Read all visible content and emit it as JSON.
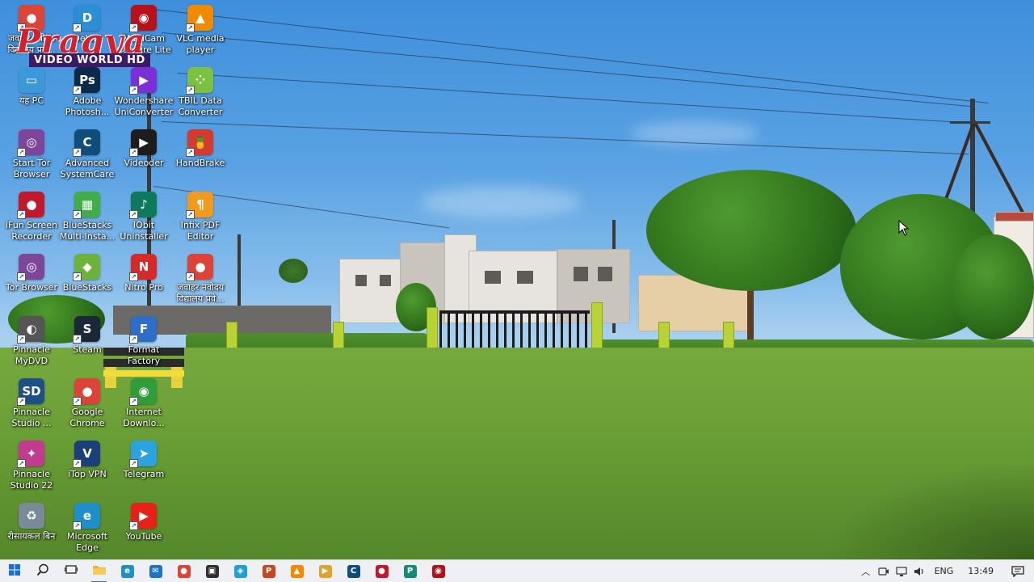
{
  "wallpaper": {
    "description_colors": {
      "sky": "#5aa2e3",
      "grass": "#6ea238",
      "fence": "#b9d334"
    }
  },
  "watermark": {
    "script_text": "Pragya",
    "band_text": "VIDEO WORLD HD"
  },
  "desktop": {
    "icons": [
      {
        "label": "जवाहर नवोदय विद्यालय प्रवे...",
        "icon": "chrome-icon",
        "color": "#db4437"
      },
      {
        "label": "Delphi",
        "icon": "delphi-icon",
        "color": "#2b8fd6"
      },
      {
        "label": "MultiCam Capture Lite",
        "icon": "multicam-icon",
        "color": "#b5121b"
      },
      {
        "label": "VLC media player",
        "icon": "vlc-icon",
        "color": "#f08a00"
      },
      {
        "label": "यह PC",
        "icon": "this-pc-icon",
        "color": "#3a9ad9"
      },
      {
        "label": "Adobe Photosh...",
        "icon": "photoshop-icon",
        "color": "#0b2a4a"
      },
      {
        "label": "Wondershare UniConverter",
        "icon": "uniconverter-icon",
        "color": "#7b2fd6"
      },
      {
        "label": "TBIL Data Converter",
        "icon": "tbil-icon",
        "color": "#7cc242"
      },
      {
        "label": "Start Tor Browser",
        "icon": "tor-icon",
        "color": "#7d4698"
      },
      {
        "label": "Advanced SystemCare",
        "icon": "systemcare-icon",
        "color": "#0f4d7a"
      },
      {
        "label": "Videoder",
        "icon": "videoder-icon",
        "color": "#1d1d1d"
      },
      {
        "label": "HandBrake",
        "icon": "handbrake-icon",
        "color": "#d43a2f"
      },
      {
        "label": "iFun Screen Recorder",
        "icon": "ifun-icon",
        "color": "#c2182b"
      },
      {
        "label": "BlueStacks Multi-Insta...",
        "icon": "bluestacks-multi-icon",
        "color": "#3fae49"
      },
      {
        "label": "IObit Uninstaller",
        "icon": "iobit-icon",
        "color": "#0e7a5c"
      },
      {
        "label": "Infix PDF Editor",
        "icon": "infix-icon",
        "color": "#f29a1e"
      },
      {
        "label": "Tor Browser",
        "icon": "tor-browser-icon",
        "color": "#7d4698"
      },
      {
        "label": "BlueStacks",
        "icon": "bluestacks-icon",
        "color": "#6cb33e"
      },
      {
        "label": "Nitro Pro",
        "icon": "nitro-icon",
        "color": "#d62a2a"
      },
      {
        "label": "जवाहर नवोदय विद्यालय प्रवे...",
        "icon": "chrome-icon",
        "color": "#db4437"
      },
      {
        "label": "Pinnacle MyDVD",
        "icon": "mydvd-icon",
        "color": "#555555"
      },
      {
        "label": "Steam",
        "icon": "steam-icon",
        "color": "#1b2838"
      },
      {
        "label": "Format Factory",
        "icon": "format-factory-icon",
        "color": "#2d6ec9"
      },
      {
        "label": "Pinnacle Studio ...",
        "icon": "pinnacle-sd-icon",
        "color": "#1e4f86"
      },
      {
        "label": "Google Chrome",
        "icon": "chrome-icon",
        "color": "#db4437"
      },
      {
        "label": "Internet Downlo...",
        "icon": "idm-icon",
        "color": "#2e9d3a"
      },
      {
        "label": "Pinnacle Studio 22",
        "icon": "pinnacle-22-icon",
        "color": "#c23b8f"
      },
      {
        "label": "iTop VPN",
        "icon": "itop-vpn-icon",
        "color": "#1a3f7a"
      },
      {
        "label": "Telegram",
        "icon": "telegram-icon",
        "color": "#2aa3de"
      },
      {
        "label": "रीसायकल बिन",
        "icon": "recycle-bin-icon",
        "color": "#7a8a99"
      },
      {
        "label": "Microsoft Edge",
        "icon": "edge-icon",
        "color": "#1e8fc9"
      },
      {
        "label": "YouTube",
        "icon": "youtube-icon",
        "color": "#e62117"
      }
    ]
  },
  "taskbar": {
    "buttons": [
      {
        "name": "start-button",
        "icon": "windows-icon",
        "glyph": "",
        "color": "#1570d6"
      },
      {
        "name": "search-button",
        "icon": "search-icon",
        "glyph": "",
        "color": "#333333"
      },
      {
        "name": "task-view-button",
        "icon": "task-view-icon",
        "glyph": "",
        "color": "#333333"
      },
      {
        "name": "file-explorer-button",
        "icon": "folder-icon",
        "glyph": "",
        "color": "#e8b43a"
      },
      {
        "name": "edge-button",
        "icon": "edge-icon",
        "glyph": "e",
        "color": "#1e8fc9"
      },
      {
        "name": "mail-button",
        "icon": "mail-icon",
        "glyph": "✉",
        "color": "#1a73c9"
      },
      {
        "name": "chrome-button",
        "icon": "chrome-icon",
        "glyph": "●",
        "color": "#db4437"
      },
      {
        "name": "store-button",
        "icon": "store-icon",
        "glyph": "▣",
        "color": "#2f2f2f"
      },
      {
        "name": "shield-button",
        "icon": "shield-icon",
        "glyph": "◈",
        "color": "#1ea0d8"
      },
      {
        "name": "powerpoint-button",
        "icon": "powerpoint-icon",
        "glyph": "P",
        "color": "#c9441f"
      },
      {
        "name": "vlc-button",
        "icon": "vlc-icon",
        "glyph": "▲",
        "color": "#f08a00"
      },
      {
        "name": "videoder-button",
        "icon": "videoder-icon",
        "glyph": "▶",
        "color": "#e2a32a"
      },
      {
        "name": "systemcare-button",
        "icon": "systemcare-icon",
        "glyph": "C",
        "color": "#0f4d7a"
      },
      {
        "name": "ifun-button",
        "icon": "ifun-icon",
        "glyph": "●",
        "color": "#c2182b"
      },
      {
        "name": "publisher-button",
        "icon": "publisher-icon",
        "glyph": "P",
        "color": "#148a78"
      },
      {
        "name": "multicam-button",
        "icon": "multicam-icon",
        "glyph": "◉",
        "color": "#b5121b"
      }
    ],
    "tray": {
      "chevron": "︿",
      "language": "ENG",
      "clock": "13:49"
    }
  }
}
